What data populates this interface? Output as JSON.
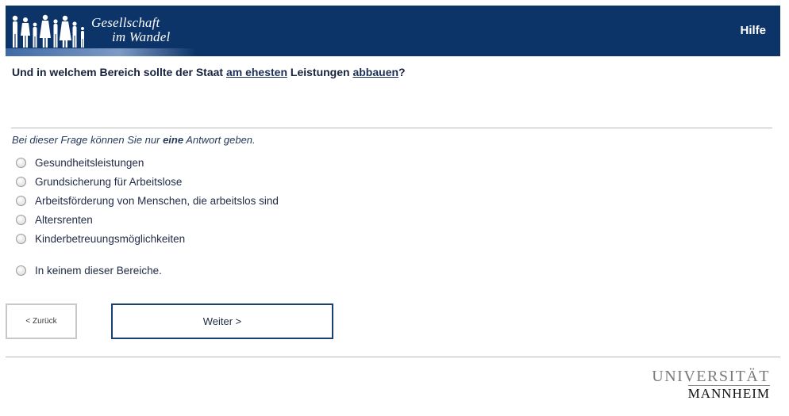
{
  "header": {
    "logo_line1": "Gesellschaft",
    "logo_line2": "im Wandel",
    "help_label": "Hilfe"
  },
  "question": {
    "part1": "Und in welchem Bereich sollte der Staat ",
    "emph1": "am ehesten",
    "part2": " Leistungen ",
    "emph2": "abbauen",
    "part3": "?"
  },
  "hint": {
    "before": "Bei dieser Frage können Sie nur ",
    "emph": "eine",
    "after": " Antwort geben."
  },
  "options": [
    "Gesundheitsleistungen",
    "Grundsicherung für Arbeitslose",
    "Arbeitsförderung von Menschen, die arbeitslos sind",
    "Altersrenten",
    "Kinderbetreuungsmöglichkeiten",
    "In keinem dieser Bereiche."
  ],
  "nav": {
    "back_label": "< Zurück",
    "next_label": "Weiter >"
  },
  "footer": {
    "uni_line1": "UNIVERSITÄT",
    "uni_line2": "MANNHEIM"
  },
  "colors": {
    "header_bg": "#0c3468",
    "next_border": "#1b3f73"
  }
}
